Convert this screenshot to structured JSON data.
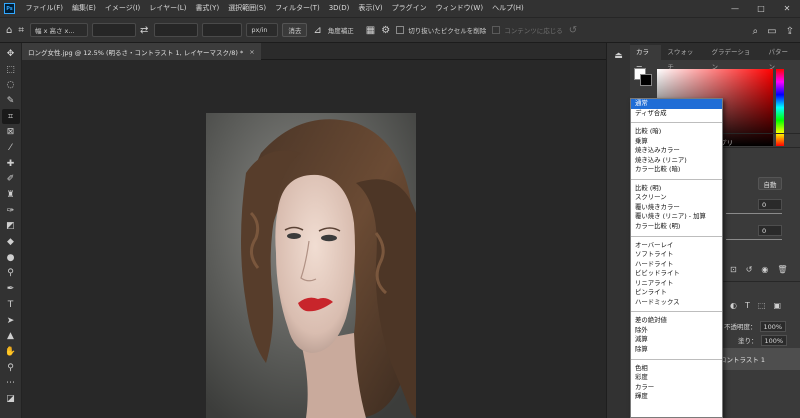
{
  "app": {
    "logo": "Ps"
  },
  "menubar": {
    "items": [
      "ファイル(F)",
      "編集(E)",
      "イメージ(I)",
      "レイヤー(L)",
      "書式(Y)",
      "選択範囲(S)",
      "フィルター(T)",
      "3D(D)",
      "表示(V)",
      "プラグイン",
      "ウィンドウ(W)",
      "ヘルプ(H)"
    ]
  },
  "options": {
    "ratio_dropdown": "幅 x 高さ x...",
    "unit_dropdown": "px/in",
    "clear_button": "消去",
    "straighten_label": "角度補正",
    "delete_cropped_label": "切り抜いたピクセルを削除",
    "content_aware_label": "コンテンツに応じる"
  },
  "document": {
    "tab_title": "ロング女性.jpg @ 12.5% (明るさ・コントラスト 1, レイヤーマスク/8) *",
    "close_glyph": "×"
  },
  "panels": {
    "tabs": [
      "カラー",
      "スウォッチ",
      "グラデーション",
      "パターン"
    ],
    "prop_tab_fragment": "プリ",
    "auto_button": "自動",
    "field_1": "0",
    "field_2": "0",
    "opacity_label": "不透明度：",
    "opacity_value": "100%",
    "fill_label": "塗り：",
    "fill_value": "100%",
    "layer_name": "コントラスト 1"
  },
  "blend_dropdown": {
    "groups": [
      [
        "通常",
        "ディザ合成"
      ],
      [
        "比較 (暗)",
        "乗算",
        "焼き込みカラー",
        "焼き込み (リニア)",
        "カラー比較 (暗)"
      ],
      [
        "比較 (明)",
        "スクリーン",
        "覆い焼きカラー",
        "覆い焼き (リニア) - 加算",
        "カラー比較 (明)"
      ],
      [
        "オーバーレイ",
        "ソフトライト",
        "ハードライト",
        "ビビッドライト",
        "リニアライト",
        "ピンライト",
        "ハードミックス"
      ],
      [
        "差の絶対値",
        "除外",
        "減算",
        "除算"
      ],
      [
        "色相",
        "彩度",
        "カラー",
        "輝度"
      ]
    ],
    "selected": "通常"
  },
  "colors": {
    "selection": "#1f6dd6",
    "app_bg": "#323232",
    "canvas_bg": "#282828"
  }
}
